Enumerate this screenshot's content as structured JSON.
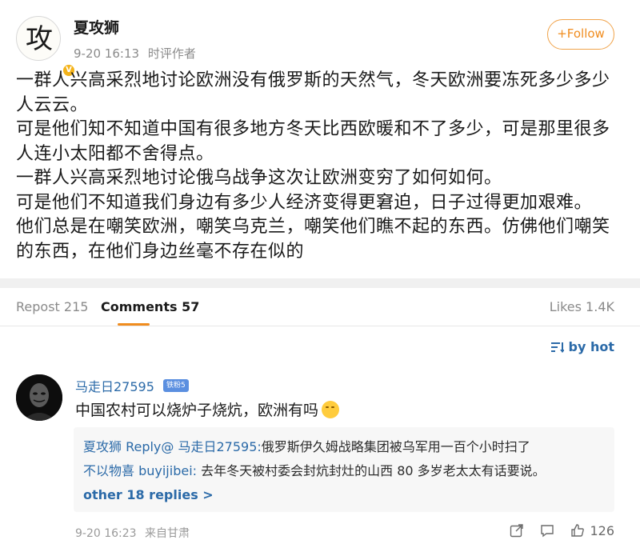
{
  "post": {
    "avatar_glyph": "攻",
    "username": "夏攻狮",
    "date": "9-20 16:13",
    "role": "时评作者",
    "follow_label": "+Follow",
    "paragraphs": [
      "一群人兴高采烈地讨论欧洲没有俄罗斯的天然气，冬天欧洲要冻死多少多少人云云。",
      "可是他们知不知道中国有很多地方冬天比西欧暖和不了多少，可是那里很多人连小太阳都不舍得点。",
      "一群人兴高采烈地讨论俄乌战争这次让欧洲变穷了如何如何。",
      "可是他们不知道我们身边有多少人经济变得更窘迫，日子过得更加艰难。",
      "他们总是在嘲笑欧洲，嘲笑乌克兰，嘲笑他们瞧不起的东西。仿佛他们嘲笑的东西，在他们身边丝毫不存在似的"
    ]
  },
  "tabs": {
    "repost": "Repost 215",
    "comments": "Comments 57",
    "likes": "Likes 1.4K"
  },
  "comments": {
    "sort_label": "by hot",
    "first": {
      "name": "马走日27595",
      "badge": "铁粉5",
      "text": "中国农村可以烧炉子烧炕，欧洲有吗",
      "replies": [
        {
          "name": "夏攻狮 Reply@ 马走日27595:",
          "text": "俄罗斯伊久姆战略集团被乌军用一百个小时扫了"
        },
        {
          "name": "不以物喜 buyijibei:",
          "text": " 去年冬天被村委会封炕封灶的山西 80 多岁老太太有话要说。"
        }
      ],
      "more_replies": "other 18 replies >",
      "date": "9-20 16:23",
      "location": "来自甘肃",
      "like_count": "126"
    }
  },
  "colors": {
    "accent_orange": "#f08c1e",
    "link_blue": "#2b6aa8"
  }
}
